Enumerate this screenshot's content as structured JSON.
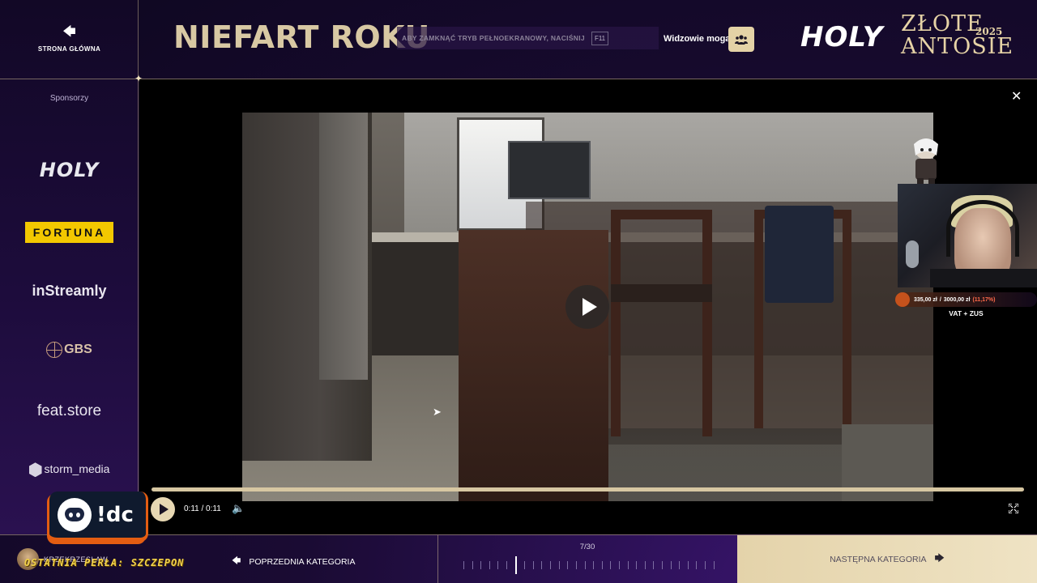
{
  "nav": {
    "home_label": "STRONA GŁÓWNA",
    "home_icon": "arrow-left-icon"
  },
  "header": {
    "category_title": "NIEFART ROKU",
    "fullscreen_hint": "ABY ZAMKNĄĆ TRYB PEŁNOEKRANOWY, NACIŚNIJ",
    "fullscreen_key": "F11",
    "viewers_label": "Widzowie mogą",
    "viewers_icon": "users-icon",
    "brand": "HOLY",
    "event_line1": "ZŁOTE",
    "event_year": "2025",
    "event_line2": "ANTOSIE"
  },
  "sponsors": {
    "title": "Sponsorzy",
    "items": [
      {
        "name": "HOLY"
      },
      {
        "name": "FORTUNA"
      },
      {
        "name": "inStreamly"
      },
      {
        "name": "GBS"
      },
      {
        "name": "feat.store"
      },
      {
        "name": "storm_media"
      }
    ]
  },
  "player": {
    "time": "0:11 / 0:11",
    "progress": 1.0,
    "close_icon": "close-icon",
    "volume_icon": "volume-icon",
    "fullscreen_icon": "fullscreen-icon"
  },
  "overlay": {
    "donation_current": "335,00 zł",
    "donation_separator": "/",
    "donation_goal": "3000,00 zł",
    "donation_percent": "(11,17%)",
    "goal_label": "VAT + ZUS"
  },
  "discord": {
    "command": "!dc"
  },
  "footer": {
    "username": "KRZEKRZESLAW",
    "ticker": "OSTATNIA PERŁA: SZCZEPON",
    "prev_label": "POPRZEDNIA KATEGORIA",
    "next_label": "NASTĘPNA KATEGORIA",
    "counter": "7/30",
    "current_index": 7,
    "total": 30
  },
  "colors": {
    "accent_gold": "#e4d2a6",
    "background": "#1a0b33",
    "donation_percent": "#ff6a4a"
  }
}
